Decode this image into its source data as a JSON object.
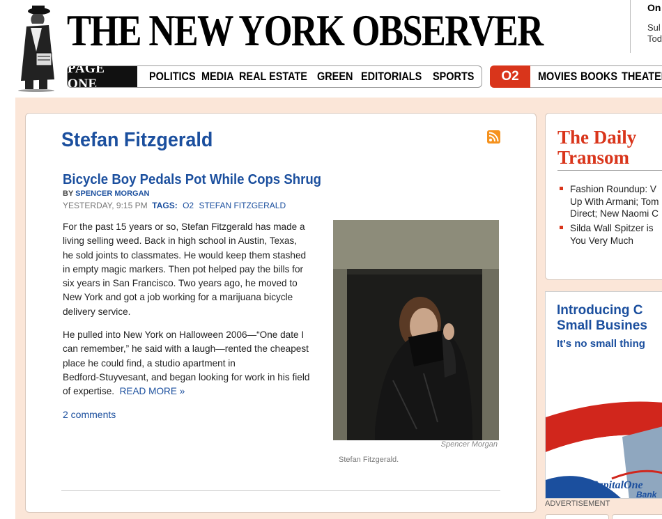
{
  "header": {
    "masthead": "THE NEW YORK OBSERVER",
    "top_right": [
      "On",
      "Sul",
      "Tod"
    ],
    "nav": {
      "page_one": "PAGE ONE",
      "items": [
        "POLITICS",
        "MEDIA",
        "REAL ESTATE",
        "GREEN",
        "EDITORIALS",
        "SPORTS"
      ],
      "o2": "O2",
      "secondary_items": [
        "MOVIES",
        "BOOKS",
        "THEATER"
      ]
    }
  },
  "main": {
    "page_title": "Stefan Fitzgerald",
    "rss_icon": "rss-feed-icon",
    "article": {
      "title": "Bicycle Boy Pedals Pot While Cops Shrug",
      "byline_prefix": "BY ",
      "author": "SPENCER MORGAN",
      "timestamp": "YESTERDAY, 9:15 PM",
      "tags_label": "TAGS:",
      "tags": [
        "O2",
        "STEFAN FITZGERALD"
      ],
      "paragraph_1_lines": [
        "For the past 15 years or so, Stefan Fitzgerald has made a",
        "living selling weed. Back in high school in Austin, Texas,",
        "he sold joints to classmates. He would keep them stashed",
        "in empty magic markers. Then pot helped pay the bills for",
        "six years in San Francisco. Two years ago, he moved to",
        "New York and got a job working for a marijuana bicycle",
        "delivery service."
      ],
      "paragraph_2_lines": [
        "He pulled into New York on Halloween 2006—“One date I",
        "can remember,” he said with a laugh—rented the cheapest",
        "place he could find, a studio apartment in",
        "Bedford-Stuyvesant, and began looking for work in his field"
      ],
      "paragraph_2_last": "of expertise.  ",
      "read_more": "READ MORE »",
      "comments": "2 comments",
      "photo_credit": "Spencer Morgan",
      "photo_caption": "Stefan Fitzgerald."
    }
  },
  "sidebar": {
    "transom_title_1": "The Daily",
    "transom_title_2": "Transom",
    "items": [
      {
        "lines": [
          "Fashion Roundup: V",
          "Up With Armani; Tom",
          "Direct; New Naomi C"
        ]
      },
      {
        "lines": [
          "Silda Wall Spitzer is",
          "You Very Much"
        ]
      }
    ],
    "ad": {
      "headline_1": "Introducing C",
      "headline_2": "Small Busines",
      "tagline": "It's no small thing",
      "brand": "CapitalOne",
      "brand_sub": "Bank"
    },
    "ad_label": "ADVERTISEMENT"
  },
  "colors": {
    "link_blue": "#1b4f9e",
    "accent_red": "#d9351b",
    "peach_background": "#fbe6d8",
    "rss_orange": "#f5921e"
  }
}
